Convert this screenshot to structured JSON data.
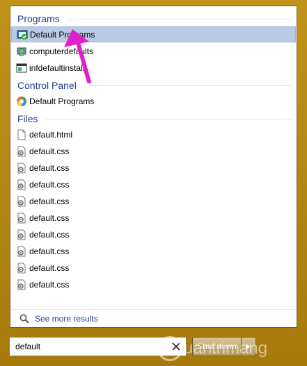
{
  "sections": {
    "programs": {
      "title": "Programs",
      "items": [
        {
          "label": "Default Programs",
          "icon": "default-programs-icon"
        },
        {
          "label": "computerdefaults",
          "icon": "computer-defaults-icon"
        },
        {
          "label": "infdefaultinstall",
          "icon": "application-window-icon"
        }
      ]
    },
    "control_panel": {
      "title": "Control Panel",
      "items": [
        {
          "label": "Default Programs",
          "icon": "default-programs-cp-icon"
        }
      ]
    },
    "files": {
      "title": "Files",
      "items": [
        {
          "label": "default.html",
          "icon": "document-icon"
        },
        {
          "label": "default.css",
          "icon": "css-file-icon"
        },
        {
          "label": "default.css",
          "icon": "css-file-icon"
        },
        {
          "label": "default.css",
          "icon": "css-file-icon"
        },
        {
          "label": "default.css",
          "icon": "css-file-icon"
        },
        {
          "label": "default.css",
          "icon": "css-file-icon"
        },
        {
          "label": "default.css",
          "icon": "css-file-icon"
        },
        {
          "label": "default.css",
          "icon": "css-file-icon"
        },
        {
          "label": "default.css",
          "icon": "css-file-icon"
        },
        {
          "label": "default.css",
          "icon": "css-file-icon"
        }
      ]
    }
  },
  "see_more": {
    "label": "See more results",
    "icon": "search-icon"
  },
  "search": {
    "value": "default"
  },
  "shutdown": {
    "label": "Shut down"
  },
  "watermark": {
    "text": "uantrimang"
  },
  "colors": {
    "accent": "#1e3f8c",
    "selection": "#b9cbe4",
    "pointer": "#e020c8"
  }
}
